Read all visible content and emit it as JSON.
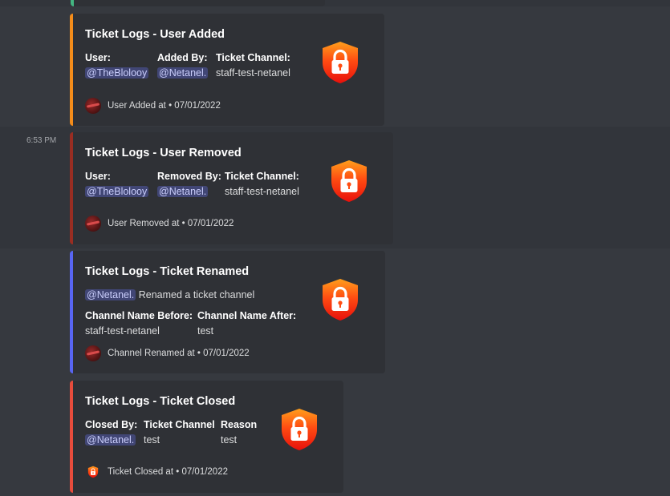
{
  "timestamp": "6:53 PM",
  "colors": {
    "accent_orange": "#f48c1a",
    "accent_darkred": "#992d22",
    "accent_blurple": "#5865f2",
    "accent_red": "#e74c3c",
    "accent_green": "#43b581",
    "mention_bg": "#414675"
  },
  "icons": {
    "thumbnail": "red-shield-lock-icon",
    "footer_avatar": "bot-avatar-icon",
    "footer_shield": "shield-icon"
  },
  "embeds": [
    {
      "title": "Ticket Logs - User Added",
      "fields": [
        {
          "name": "User:",
          "value": "@TheBlolooy",
          "mention": true
        },
        {
          "name": "Added By:",
          "value": "@Netanel.",
          "mention": true
        },
        {
          "name": "Ticket Channel:",
          "value": "staff-test-netanel",
          "mention": false
        }
      ],
      "footer": "User Added at • 07/01/2022"
    },
    {
      "title": "Ticket Logs - User Removed",
      "fields": [
        {
          "name": "User:",
          "value": "@TheBlolooy",
          "mention": true
        },
        {
          "name": "Removed By:",
          "value": "@Netanel.",
          "mention": true
        },
        {
          "name": "Ticket Channel:",
          "value": "staff-test-netanel",
          "mention": false
        }
      ],
      "footer": "User Removed at • 07/01/2022"
    },
    {
      "title": "Ticket Logs - Ticket Renamed",
      "description_mention": "@Netanel.",
      "description_text": " Renamed a ticket channel",
      "fields": [
        {
          "name": "Channel Name Before:",
          "value": "staff-test-netanel",
          "mention": false
        },
        {
          "name": "Channel Name After:",
          "value": "test",
          "mention": false
        }
      ],
      "footer": "Channel Renamed at • 07/01/2022"
    },
    {
      "title": "Ticket Logs - Ticket Closed",
      "fields": [
        {
          "name": "Closed By:",
          "value": "@Netanel.",
          "mention": true
        },
        {
          "name": "Ticket Channel",
          "value": "test",
          "mention": false
        },
        {
          "name": "Reason",
          "value": "test",
          "mention": false
        }
      ],
      "footer": "Ticket Closed at • 07/01/2022"
    }
  ]
}
